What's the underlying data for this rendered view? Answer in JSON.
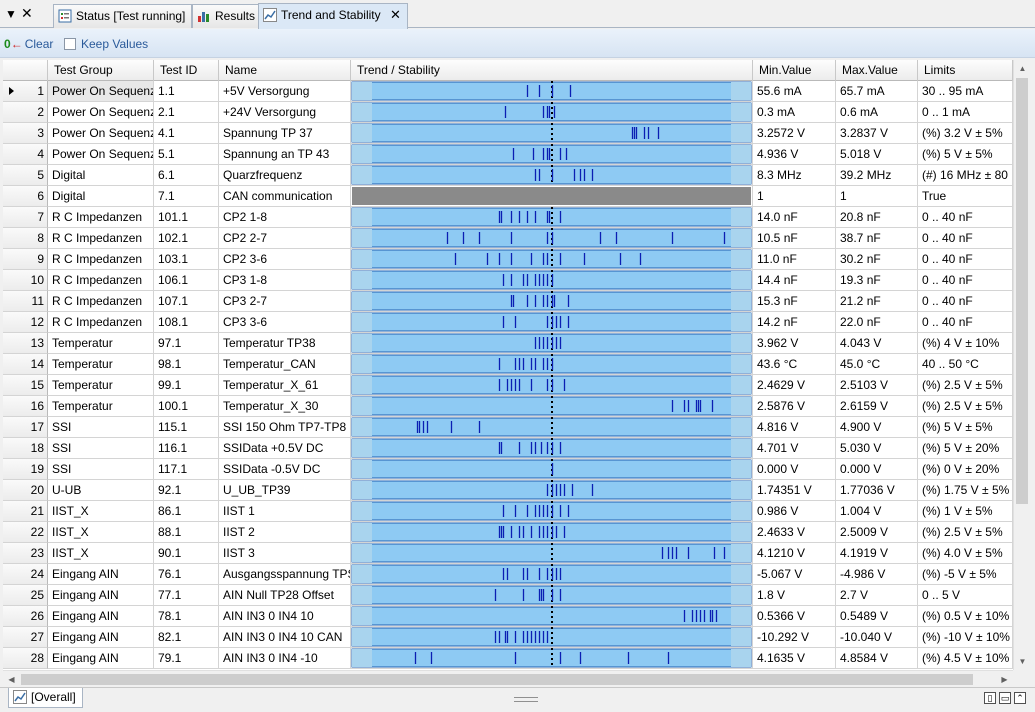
{
  "tabs": [
    {
      "label": "Status [Test running]",
      "icon": "status-icon"
    },
    {
      "label": "Results",
      "icon": "bar-chart-icon"
    },
    {
      "label": "Trend and Stability",
      "icon": "trend-icon",
      "active": true
    }
  ],
  "toolbar": {
    "clear_zero": "0",
    "clear_label": "Clear",
    "keep_label": "Keep Values"
  },
  "columns": [
    "Test Group",
    "Test ID",
    "Name",
    "Trend / Stability",
    "Min.Value",
    "Max.Value",
    "Limits"
  ],
  "rows": [
    {
      "n": "1",
      "group": "Power On Sequenz",
      "id": "1.1",
      "name": "+5V Versorgung",
      "min": "55.6 mA",
      "max": "65.7 mA",
      "limits": "30 .. 95 mA",
      "marks": [
        0.44,
        0.47,
        0.5,
        0.545
      ]
    },
    {
      "n": "2",
      "group": "Power On Sequenz",
      "id": "2.1",
      "name": "+24V Versorgung",
      "min": "0.3 mA",
      "max": "0.6 mA",
      "limits": "0 .. 1 mA",
      "marks": [
        0.385,
        0.48,
        0.49,
        0.495,
        0.505
      ]
    },
    {
      "n": "3",
      "group": "Power On Sequenz",
      "id": "4.1",
      "name": "Spannung TP 37",
      "min": "3.2572 V",
      "max": "3.2837 V",
      "limits": "(%) 3.2 V ± 5%",
      "marks": [
        0.7,
        0.705,
        0.71,
        0.73,
        0.74,
        0.765
      ]
    },
    {
      "n": "4",
      "group": "Power On Sequenz",
      "id": "5.1",
      "name": "Spannung an TP 43",
      "min": "4.936 V",
      "max": "5.018 V",
      "limits": "(%) 5 V ± 5%",
      "marks": [
        0.405,
        0.455,
        0.48,
        0.49,
        0.495,
        0.52,
        0.535
      ]
    },
    {
      "n": "5",
      "group": "Digital",
      "id": "6.1",
      "name": "Quarzfrequenz",
      "min": "8.3 MHz",
      "max": "39.2 MHz",
      "limits": "(#) 16 MHz ± 80 M",
      "marks": [
        0.46,
        0.47,
        0.5,
        0.555,
        0.57,
        0.58,
        0.6
      ]
    },
    {
      "n": "6",
      "group": "Digital",
      "id": "7.1",
      "name": "CAN communication",
      "min": "1",
      "max": "1",
      "limits": "True",
      "marks": [],
      "disabled": true
    },
    {
      "n": "7",
      "group": "R C Impedanzen",
      "id": "101.1",
      "name": "CP2 1-8",
      "min": "14.0 nF",
      "max": "20.8 nF",
      "limits": "0 .. 40 nF",
      "marks": [
        0.37,
        0.375,
        0.4,
        0.42,
        0.44,
        0.46,
        0.49,
        0.495,
        0.52
      ]
    },
    {
      "n": "8",
      "group": "R C Impedanzen",
      "id": "102.1",
      "name": "CP2 2-7",
      "min": "10.5 nF",
      "max": "38.7 nF",
      "limits": "0 .. 40 nF",
      "marks": [
        0.24,
        0.28,
        0.32,
        0.4,
        0.49,
        0.5,
        0.62,
        0.66,
        0.8,
        0.93
      ]
    },
    {
      "n": "9",
      "group": "R C Impedanzen",
      "id": "103.1",
      "name": "CP2 3-6",
      "min": "11.0 nF",
      "max": "30.2 nF",
      "limits": "0 .. 40 nF",
      "marks": [
        0.26,
        0.34,
        0.37,
        0.4,
        0.45,
        0.48,
        0.49,
        0.52,
        0.58,
        0.67,
        0.72
      ]
    },
    {
      "n": "10",
      "group": "R C Impedanzen",
      "id": "106.1",
      "name": "CP3 1-8",
      "min": "14.4 nF",
      "max": "19.3 nF",
      "limits": "0 .. 40 nF",
      "marks": [
        0.38,
        0.4,
        0.43,
        0.44,
        0.46,
        0.47,
        0.48,
        0.49,
        0.5
      ]
    },
    {
      "n": "11",
      "group": "R C Impedanzen",
      "id": "107.1",
      "name": "CP3 2-7",
      "min": "15.3 nF",
      "max": "21.2 nF",
      "limits": "0 .. 40 nF",
      "marks": [
        0.4,
        0.405,
        0.44,
        0.46,
        0.48,
        0.49,
        0.5,
        0.505,
        0.54
      ]
    },
    {
      "n": "12",
      "group": "R C Impedanzen",
      "id": "108.1",
      "name": "CP3 3-6",
      "min": "14.2 nF",
      "max": "22.0 nF",
      "limits": "0 .. 40 nF",
      "marks": [
        0.38,
        0.41,
        0.49,
        0.5,
        0.51,
        0.52,
        0.54
      ]
    },
    {
      "n": "13",
      "group": "Temperatur",
      "id": "97.1",
      "name": "Temperatur TP38",
      "min": "3.962 V",
      "max": "4.043 V",
      "limits": "(%) 4 V ± 10%",
      "marks": [
        0.46,
        0.47,
        0.48,
        0.49,
        0.5,
        0.51,
        0.52
      ]
    },
    {
      "n": "14",
      "group": "Temperatur",
      "id": "98.1",
      "name": "Temperatur_CAN",
      "min": "43.6 °C",
      "max": "45.0 °C",
      "limits": "40 .. 50 °C",
      "marks": [
        0.37,
        0.41,
        0.42,
        0.43,
        0.45,
        0.46,
        0.48,
        0.49,
        0.5
      ]
    },
    {
      "n": "15",
      "group": "Temperatur",
      "id": "99.1",
      "name": "Temperatur_X_61",
      "min": "2.4629 V",
      "max": "2.5103 V",
      "limits": "(%) 2.5 V ± 5%",
      "marks": [
        0.37,
        0.39,
        0.4,
        0.41,
        0.42,
        0.45,
        0.49,
        0.5,
        0.53
      ]
    },
    {
      "n": "16",
      "group": "Temperatur",
      "id": "100.1",
      "name": "Temperatur_X_30",
      "min": "2.5876 V",
      "max": "2.6159 V",
      "limits": "(%) 2.5 V ± 5%",
      "marks": [
        0.8,
        0.83,
        0.84,
        0.86,
        0.865,
        0.87,
        0.9
      ]
    },
    {
      "n": "17",
      "group": "SSI",
      "id": "115.1",
      "name": "SSI 150 Ohm TP7-TP8",
      "min": "4.816 V",
      "max": "4.900 V",
      "limits": "(%) 5 V ± 5%",
      "marks": [
        0.165,
        0.17,
        0.18,
        0.19,
        0.25,
        0.32
      ]
    },
    {
      "n": "18",
      "group": "SSI",
      "id": "116.1",
      "name": "SSIData +0.5V DC",
      "min": "4.701 V",
      "max": "5.030 V",
      "limits": "(%) 5 V ± 20%",
      "marks": [
        0.37,
        0.375,
        0.42,
        0.45,
        0.46,
        0.475,
        0.49,
        0.5,
        0.52
      ]
    },
    {
      "n": "19",
      "group": "SSI",
      "id": "117.1",
      "name": "SSIData -0.5V DC",
      "min": "0.000 V",
      "max": "0.000 V",
      "limits": "(%) 0 V ± 20%",
      "marks": [
        0.5
      ]
    },
    {
      "n": "20",
      "group": "U-UB",
      "id": "92.1",
      "name": "U_UB_TP39",
      "min": "1.74351 V",
      "max": "1.77036 V",
      "limits": "(%) 1.75 V ± 5%",
      "marks": [
        0.49,
        0.5,
        0.51,
        0.52,
        0.53,
        0.55,
        0.6
      ]
    },
    {
      "n": "21",
      "group": "IIST_X",
      "id": "86.1",
      "name": "IIST 1",
      "min": "0.986 V",
      "max": "1.004 V",
      "limits": "(%) 1 V ± 5%",
      "marks": [
        0.38,
        0.41,
        0.44,
        0.46,
        0.47,
        0.48,
        0.49,
        0.5,
        0.52,
        0.54
      ]
    },
    {
      "n": "22",
      "group": "IIST_X",
      "id": "88.1",
      "name": "IIST 2",
      "min": "2.4633 V",
      "max": "2.5009 V",
      "limits": "(%) 2.5 V ± 5%",
      "marks": [
        0.37,
        0.375,
        0.38,
        0.4,
        0.42,
        0.43,
        0.45,
        0.47,
        0.48,
        0.49,
        0.5,
        0.51,
        0.53
      ]
    },
    {
      "n": "23",
      "group": "IIST_X",
      "id": "90.1",
      "name": "IIST 3",
      "min": "4.1210 V",
      "max": "4.1919 V",
      "limits": "(%) 4.0 V ± 5%",
      "marks": [
        0.775,
        0.79,
        0.8,
        0.81,
        0.84,
        0.905,
        0.93
      ]
    },
    {
      "n": "24",
      "group": "Eingang AIN",
      "id": "76.1",
      "name": "Ausgangsspannung TPS",
      "min": "-5.067 V",
      "max": "-4.986 V",
      "limits": "(%) -5 V ± 5%",
      "marks": [
        0.38,
        0.39,
        0.43,
        0.44,
        0.47,
        0.49,
        0.5,
        0.51,
        0.52
      ]
    },
    {
      "n": "25",
      "group": "Eingang AIN",
      "id": "77.1",
      "name": "AIN Null TP28 Offset",
      "min": "1.8 V",
      "max": "2.7 V",
      "limits": "0 .. 5 V",
      "marks": [
        0.36,
        0.43,
        0.47,
        0.475,
        0.48,
        0.5,
        0.52
      ]
    },
    {
      "n": "26",
      "group": "Eingang AIN",
      "id": "78.1",
      "name": "AIN IN3  0 IN4 10",
      "min": "0.5366 V",
      "max": "0.5489 V",
      "limits": "(%) 0.5 V ± 10%",
      "marks": [
        0.83,
        0.85,
        0.86,
        0.87,
        0.88,
        0.895,
        0.9,
        0.91
      ]
    },
    {
      "n": "27",
      "group": "Eingang AIN",
      "id": "82.1",
      "name": "AIN IN3  0 IN4 10 CAN",
      "min": "-10.292 V",
      "max": "-10.040 V",
      "limits": "(%) -10 V ± 10%",
      "marks": [
        0.36,
        0.37,
        0.385,
        0.39,
        0.41,
        0.43,
        0.44,
        0.45,
        0.46,
        0.47,
        0.48,
        0.49
      ]
    },
    {
      "n": "28",
      "group": "Eingang AIN",
      "id": "79.1",
      "name": "AIN IN3 0 IN4 -10",
      "min": "4.1635 V",
      "max": "4.8584 V",
      "limits": "(%) 4.5 V ± 10%",
      "marks": [
        0.16,
        0.2,
        0.41,
        0.52,
        0.57,
        0.69,
        0.79
      ]
    }
  ],
  "bottom_tab": {
    "label": "[Overall]",
    "icon": "trend-icon"
  },
  "colors": {
    "trend_fill": "#8ecaf3",
    "trend_margin": "#a9d4ee",
    "trend_mark": "#0b1fb3",
    "disabled": "#8a8a8a"
  }
}
